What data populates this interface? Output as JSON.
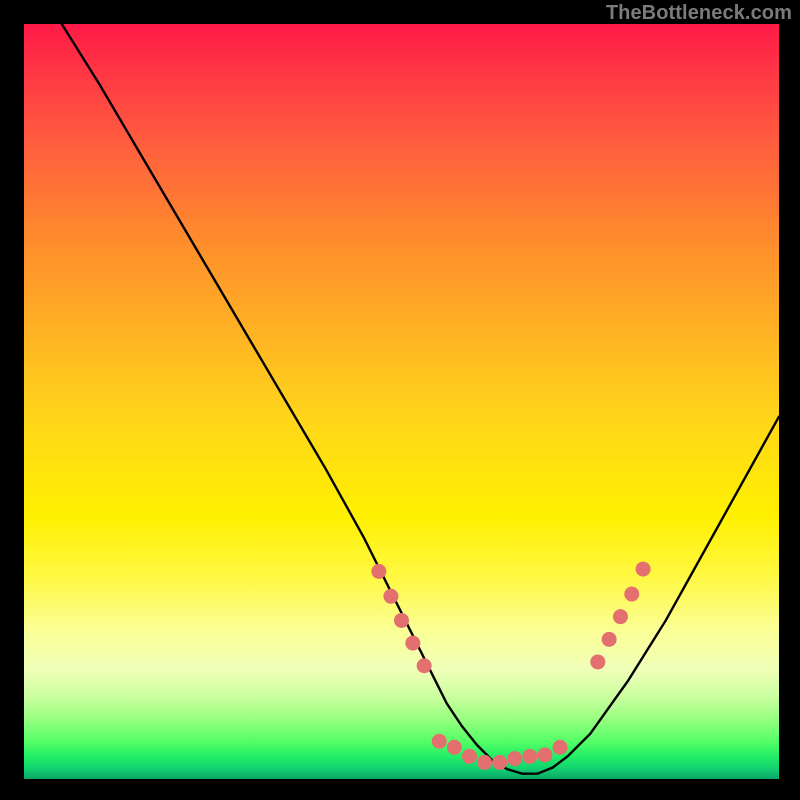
{
  "watermark": "TheBottleneck.com",
  "chart_data": {
    "type": "line",
    "title": "",
    "xlabel": "",
    "ylabel": "",
    "xlim": [
      0,
      100
    ],
    "ylim": [
      0,
      100
    ],
    "series": [
      {
        "name": "bottleneck-curve",
        "x": [
          5,
          10,
          15,
          20,
          25,
          30,
          35,
          40,
          45,
          50,
          52,
          54,
          56,
          58,
          60,
          62,
          64,
          66,
          68,
          70,
          72,
          75,
          80,
          85,
          90,
          95,
          100
        ],
        "y": [
          100,
          92,
          83.5,
          75,
          66.5,
          58,
          49.5,
          41,
          32,
          22,
          18,
          14,
          10,
          7,
          4.5,
          2.5,
          1.3,
          0.7,
          0.7,
          1.5,
          3,
          6,
          13,
          21,
          30,
          39,
          48
        ]
      }
    ],
    "markers": {
      "name": "highlight-dots",
      "color": "#e3706e",
      "radius": 7.5,
      "points": [
        {
          "x": 47.0,
          "y": 27.5
        },
        {
          "x": 48.6,
          "y": 24.2
        },
        {
          "x": 50.0,
          "y": 21.0
        },
        {
          "x": 51.5,
          "y": 18.0
        },
        {
          "x": 53.0,
          "y": 15.0
        },
        {
          "x": 55.0,
          "y": 5.0
        },
        {
          "x": 57.0,
          "y": 4.2
        },
        {
          "x": 59.0,
          "y": 3.0
        },
        {
          "x": 61.0,
          "y": 2.2
        },
        {
          "x": 63.0,
          "y": 2.2
        },
        {
          "x": 65.0,
          "y": 2.7
        },
        {
          "x": 67.0,
          "y": 3.0
        },
        {
          "x": 69.0,
          "y": 3.2
        },
        {
          "x": 71.0,
          "y": 4.2
        },
        {
          "x": 76.0,
          "y": 15.5
        },
        {
          "x": 77.5,
          "y": 18.5
        },
        {
          "x": 79.0,
          "y": 21.5
        },
        {
          "x": 80.5,
          "y": 24.5
        },
        {
          "x": 82.0,
          "y": 27.8
        }
      ]
    },
    "gradient_bands": [
      {
        "color": "#ff1a48",
        "stop": 0
      },
      {
        "color": "#ffd51a",
        "stop": 52
      },
      {
        "color": "#fff000",
        "stop": 65
      },
      {
        "color": "#55ff66",
        "stop": 95
      },
      {
        "color": "#0aa868",
        "stop": 100
      }
    ]
  }
}
